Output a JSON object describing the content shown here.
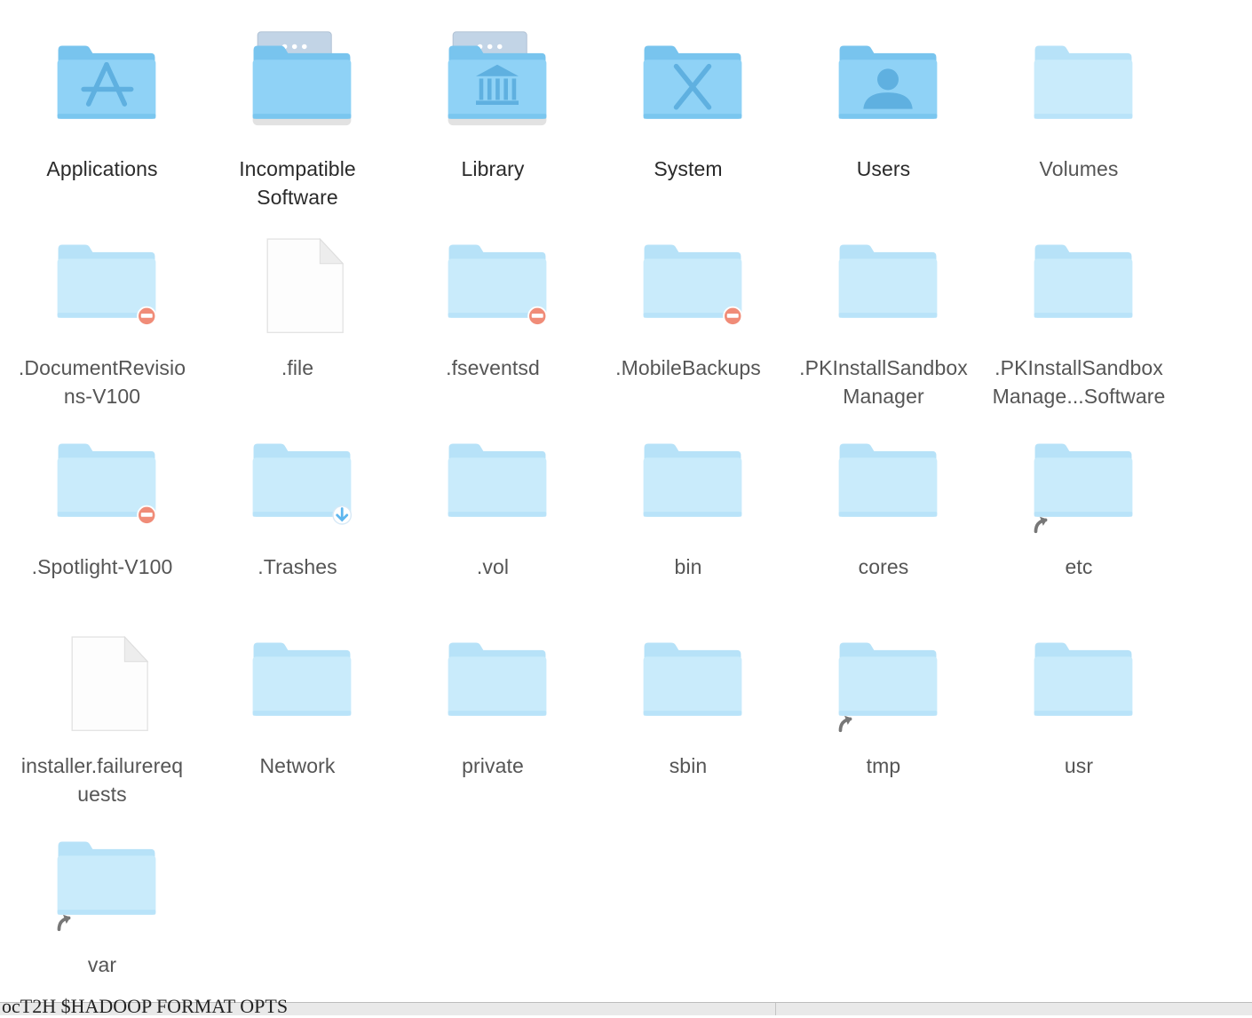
{
  "window": {
    "view": "icon-view"
  },
  "items": [
    {
      "l1": "Applications",
      "l2": "",
      "icon": "folder-applications-icon",
      "kind": "folder",
      "glyph": "applications",
      "badge": "none",
      "faded": false
    },
    {
      "l1": "Incompatible",
      "l2": "Software",
      "icon": "folder-incompatible-software-icon",
      "kind": "folder",
      "glyph": "tray",
      "badge": "none",
      "faded": false
    },
    {
      "l1": "Library",
      "l2": "",
      "icon": "folder-library-icon",
      "kind": "folder",
      "glyph": "library",
      "badge": "none",
      "faded": false
    },
    {
      "l1": "System",
      "l2": "",
      "icon": "folder-system-icon",
      "kind": "folder",
      "glyph": "system",
      "badge": "none",
      "faded": false
    },
    {
      "l1": "Users",
      "l2": "",
      "icon": "folder-users-icon",
      "kind": "folder",
      "glyph": "users",
      "badge": "none",
      "faded": false
    },
    {
      "l1": "Volumes",
      "l2": "",
      "icon": "folder-volumes-icon",
      "kind": "folder",
      "glyph": "none",
      "badge": "none",
      "faded": true
    },
    {
      "l1": ".DocumentRevisio",
      "l2": "ns-V100",
      "icon": "folder-icon",
      "kind": "folder",
      "glyph": "none",
      "badge": "no-access",
      "faded": true
    },
    {
      "l1": ".file",
      "l2": "",
      "icon": "document-icon",
      "kind": "file",
      "glyph": "none",
      "badge": "none",
      "faded": true
    },
    {
      "l1": ".fseventsd",
      "l2": "",
      "icon": "folder-icon",
      "kind": "folder",
      "glyph": "none",
      "badge": "no-access",
      "faded": true
    },
    {
      "l1": ".MobileBackups",
      "l2": "",
      "icon": "folder-icon",
      "kind": "folder",
      "glyph": "none",
      "badge": "no-access",
      "faded": true
    },
    {
      "l1": ".PKInstallSandbox",
      "l2": "Manager",
      "icon": "folder-icon",
      "kind": "folder",
      "glyph": "none",
      "badge": "none",
      "faded": true
    },
    {
      "l1": ".PKInstallSandbox",
      "l2": "Manage...Software",
      "icon": "folder-icon",
      "kind": "folder",
      "glyph": "none",
      "badge": "none",
      "faded": true
    },
    {
      "l1": ".Spotlight-V100",
      "l2": "",
      "icon": "folder-icon",
      "kind": "folder",
      "glyph": "none",
      "badge": "no-access",
      "faded": true
    },
    {
      "l1": ".Trashes",
      "l2": "",
      "icon": "folder-icon",
      "kind": "folder",
      "glyph": "none",
      "badge": "drop-box",
      "faded": true
    },
    {
      "l1": ".vol",
      "l2": "",
      "icon": "folder-icon",
      "kind": "folder",
      "glyph": "none",
      "badge": "none",
      "faded": true
    },
    {
      "l1": "bin",
      "l2": "",
      "icon": "folder-icon",
      "kind": "folder",
      "glyph": "none",
      "badge": "none",
      "faded": true
    },
    {
      "l1": "cores",
      "l2": "",
      "icon": "folder-icon",
      "kind": "folder",
      "glyph": "none",
      "badge": "none",
      "faded": true
    },
    {
      "l1": "etc",
      "l2": "",
      "icon": "folder-alias-icon",
      "kind": "folder",
      "glyph": "none",
      "badge": "alias",
      "faded": true
    },
    {
      "l1": "installer.failurereq",
      "l2": "uests",
      "icon": "document-icon",
      "kind": "file",
      "glyph": "none",
      "badge": "none",
      "faded": true
    },
    {
      "l1": "Network",
      "l2": "",
      "icon": "folder-icon",
      "kind": "folder",
      "glyph": "none",
      "badge": "none",
      "faded": true
    },
    {
      "l1": "private",
      "l2": "",
      "icon": "folder-icon",
      "kind": "folder",
      "glyph": "none",
      "badge": "none",
      "faded": true
    },
    {
      "l1": "sbin",
      "l2": "",
      "icon": "folder-icon",
      "kind": "folder",
      "glyph": "none",
      "badge": "none",
      "faded": true
    },
    {
      "l1": "tmp",
      "l2": "",
      "icon": "folder-alias-icon",
      "kind": "folder",
      "glyph": "none",
      "badge": "alias",
      "faded": true
    },
    {
      "l1": "usr",
      "l2": "",
      "icon": "folder-icon",
      "kind": "folder",
      "glyph": "none",
      "badge": "none",
      "faded": true
    },
    {
      "l1": "var",
      "l2": "",
      "icon": "folder-alias-icon",
      "kind": "folder",
      "glyph": "none",
      "badge": "alias",
      "faded": true
    }
  ],
  "terminal_fragment": "ocT2H $HADOOP FORMAT OPTS",
  "colors": {
    "folder_front": "#8fd2f6",
    "folder_back": "#78c4ee",
    "folder_front_faded": "#c9ebfb",
    "folder_back_faded": "#b7e2f8",
    "glyph": "#5fb0e0",
    "no_access_badge": "#f08c78",
    "drop_badge": "#5eb6ee",
    "alias_arrow": "#777777"
  }
}
